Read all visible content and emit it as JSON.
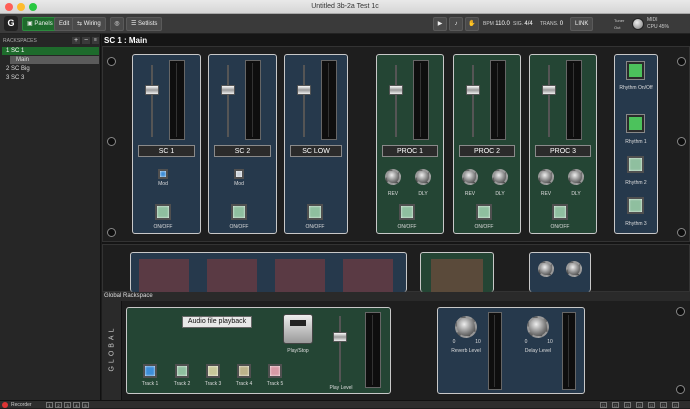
{
  "window": {
    "title": "Untitled 3b-2a Test 1c"
  },
  "toolbar": {
    "panels": "Panels",
    "edit": "Edit",
    "wiring": "Wiring",
    "setlists": "Setlists",
    "bpm_label": "BPM",
    "bpm": "110.0",
    "sig_label": "SIG.",
    "sig": "4/4",
    "trans_label": "TRANS.",
    "trans": "0",
    "link": "LINK",
    "midi": "MIDI",
    "cpu_label": "CPU",
    "cpu": "45%",
    "tuner": "Tuner",
    "out": "Out"
  },
  "sidebar": {
    "header": "RACKSPACES",
    "items": [
      {
        "label": "1  SC 1"
      },
      {
        "label": "Main"
      },
      {
        "label": "2  SC Big"
      },
      {
        "label": "3  SC 3"
      }
    ]
  },
  "rackspace": {
    "title": "SC 1 : Main"
  },
  "channels": [
    {
      "name": "SC 1"
    },
    {
      "name": "SC 2"
    },
    {
      "name": "SC LOW"
    },
    {
      "name": "PROC 1"
    },
    {
      "name": "PROC 2"
    },
    {
      "name": "PROC 3"
    }
  ],
  "labels": {
    "mod": "Mod",
    "onoff": "ON/OFF",
    "rev": "REV",
    "dly": "DLY"
  },
  "rhythm": {
    "onoff": "Rhythm On/Off",
    "r1": "Rhythm 1",
    "r2": "Rhythm 2",
    "r3": "Rhythm 3"
  },
  "global": {
    "header": "Global Rackspace",
    "side": "GLOBAL",
    "audio_title": "Audio file playback",
    "play_stop": "Play/Stop",
    "play_level": "Play Level",
    "tracks": [
      "Track 1",
      "Track 2",
      "Track 3",
      "Track 4",
      "Track 5"
    ],
    "reverb_level": "Reverb Level",
    "delay_level": "Delay Level",
    "zero": "0",
    "ten": "10"
  },
  "colors": {
    "accent": "#1e6b2c",
    "panel_blue": "#26394c",
    "panel_green": "#244534",
    "track_colors": [
      "#3d8ed8",
      "#8fbf9f",
      "#c8c89a",
      "#bcb28a",
      "#d89aa6"
    ]
  },
  "status": {
    "recorder": "Recorder",
    "pages": [
      "1",
      "2",
      "3",
      "4",
      "5"
    ]
  }
}
